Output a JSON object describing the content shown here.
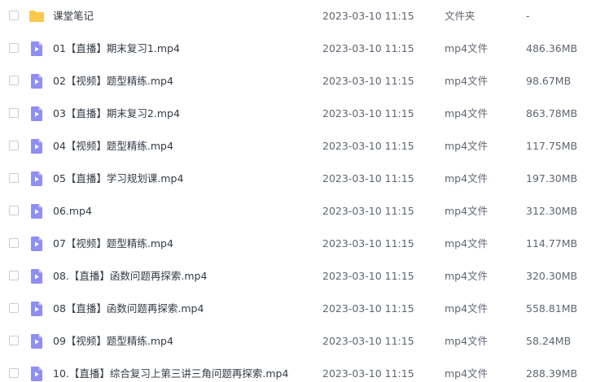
{
  "colors": {
    "folder_icon": "#f9c94d",
    "video_icon": "#8f8ef4"
  },
  "files": [
    {
      "icon": "folder-icon",
      "name": "课堂笔记",
      "date": "2023-03-10 11:15",
      "type": "文件夹",
      "size": "-"
    },
    {
      "icon": "video-file-icon",
      "name": "01【直播】期末复习1.mp4",
      "date": "2023-03-10 11:15",
      "type": "mp4文件",
      "size": "486.36MB"
    },
    {
      "icon": "video-file-icon",
      "name": "02【视频】题型精练.mp4",
      "date": "2023-03-10 11:15",
      "type": "mp4文件",
      "size": "98.67MB"
    },
    {
      "icon": "video-file-icon",
      "name": "03【直播】期末复习2.mp4",
      "date": "2023-03-10 11:15",
      "type": "mp4文件",
      "size": "863.78MB"
    },
    {
      "icon": "video-file-icon",
      "name": "04【视频】题型精练.mp4",
      "date": "2023-03-10 11:15",
      "type": "mp4文件",
      "size": "117.75MB"
    },
    {
      "icon": "video-file-icon",
      "name": "05【直播】学习规划课.mp4",
      "date": "2023-03-10 11:15",
      "type": "mp4文件",
      "size": "197.30MB"
    },
    {
      "icon": "video-file-icon",
      "name": "06.mp4",
      "date": "2023-03-10 11:15",
      "type": "mp4文件",
      "size": "312.30MB"
    },
    {
      "icon": "video-file-icon",
      "name": "07【视频】题型精练.mp4",
      "date": "2023-03-10 11:15",
      "type": "mp4文件",
      "size": "114.77MB"
    },
    {
      "icon": "video-file-icon",
      "name": "08.【直播】函数问题再探索.mp4",
      "date": "2023-03-10 11:15",
      "type": "mp4文件",
      "size": "320.30MB"
    },
    {
      "icon": "video-file-icon",
      "name": "08【直播】函数问题再探索.mp4",
      "date": "2023-03-10 11:15",
      "type": "mp4文件",
      "size": "558.81MB"
    },
    {
      "icon": "video-file-icon",
      "name": "09【视频】题型精练.mp4",
      "date": "2023-03-10 11:15",
      "type": "mp4文件",
      "size": "58.24MB"
    },
    {
      "icon": "video-file-icon",
      "name": "10.【直播】综合复习上第三讲三角问题再探索.mp4",
      "date": "2023-03-10 11:15",
      "type": "mp4文件",
      "size": "288.39MB"
    }
  ]
}
